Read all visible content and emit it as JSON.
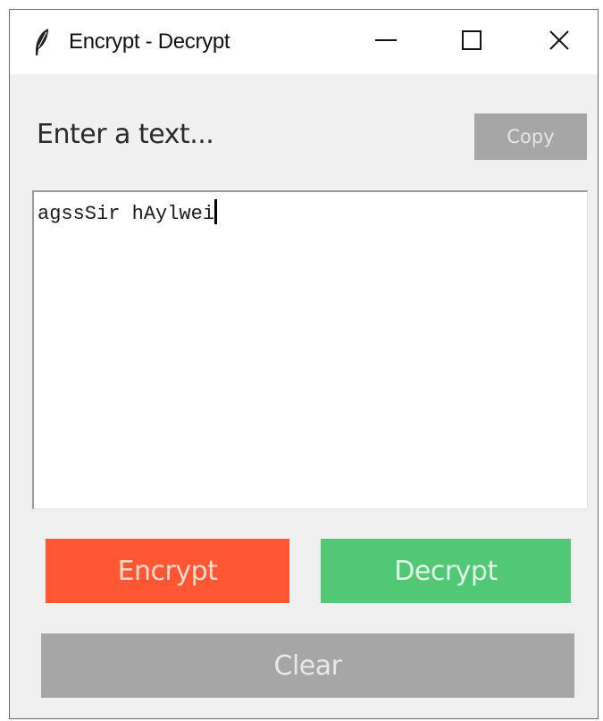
{
  "window": {
    "title": "Encrypt - Decrypt",
    "app_icon": "feather-icon",
    "controls": {
      "minimize_icon": "minimize-icon",
      "maximize_icon": "maximize-icon",
      "close_icon": "close-icon"
    }
  },
  "main": {
    "prompt_label": "Enter a text...",
    "copy_label": "Copy",
    "text_value": "agssSir hAylwei",
    "encrypt_label": "Encrypt",
    "decrypt_label": "Decrypt",
    "clear_label": "Clear"
  },
  "colors": {
    "encrypt": "#ff5733",
    "decrypt": "#52c776",
    "neutral_button": "#a6a6a6",
    "background": "#f0f0f0"
  }
}
